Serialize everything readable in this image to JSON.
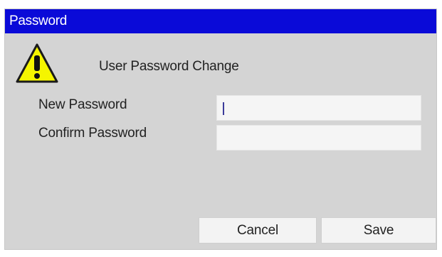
{
  "window": {
    "title": "Password",
    "title_bar_color": "#0a0ad8"
  },
  "dialog": {
    "icon": "warning-icon",
    "heading": "User Password Change",
    "fields": [
      {
        "label": "New Password",
        "value": ""
      },
      {
        "label": "Confirm Password",
        "value": ""
      }
    ],
    "buttons": {
      "cancel": "Cancel",
      "save": "Save"
    }
  }
}
